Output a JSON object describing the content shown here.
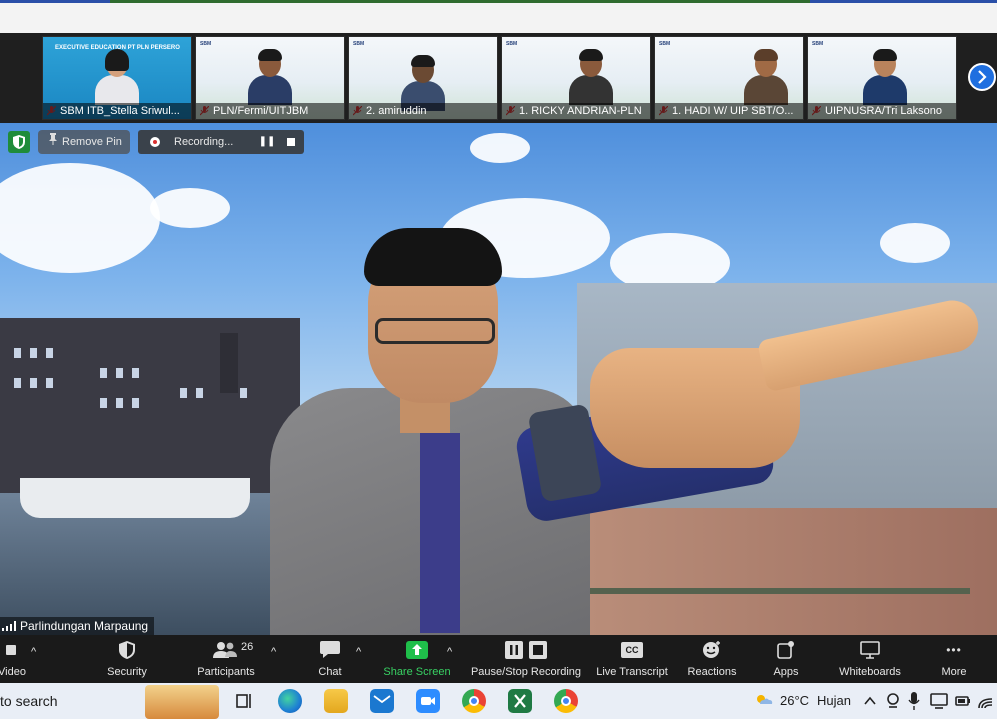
{
  "thumbnails": [
    {
      "name": "SBM ITB_Stella Sriwul...",
      "slide_text": "EXECUTIVE EDUCATION PT PLN PERSERO"
    },
    {
      "name": "PLN/Fermi/UITJBM"
    },
    {
      "name": "2. amiruddin"
    },
    {
      "name": "1. RICKY ANDRIAN-PLN"
    },
    {
      "name": "1. HADI W/ UIP SBT/O..."
    },
    {
      "name": "UIPNUSRA/Tri Laksono"
    }
  ],
  "overlay": {
    "remove_pin": "Remove Pin",
    "recording": "Recording...",
    "pause_glyph": "❚❚",
    "speaker_name": "Parlindungan Marpaung"
  },
  "toolbar": {
    "video": "Video",
    "security": "Security",
    "participants": "Participants",
    "participants_count": "26",
    "chat": "Chat",
    "share_screen": "Share Screen",
    "pause_stop": "Pause/Stop Recording",
    "live_transcript": "Live Transcript",
    "cc": "CC",
    "reactions": "Reactions",
    "apps": "Apps",
    "whiteboards": "Whiteboards",
    "more": "More",
    "more_glyph": "•••",
    "caret": "^"
  },
  "taskbar": {
    "search": "to search",
    "temperature": "26°C",
    "weather": "Hujan"
  },
  "colors": {
    "share_green": "#1fbf4a",
    "record_red": "#d93030",
    "pin_blue": "#1f6fe0"
  }
}
